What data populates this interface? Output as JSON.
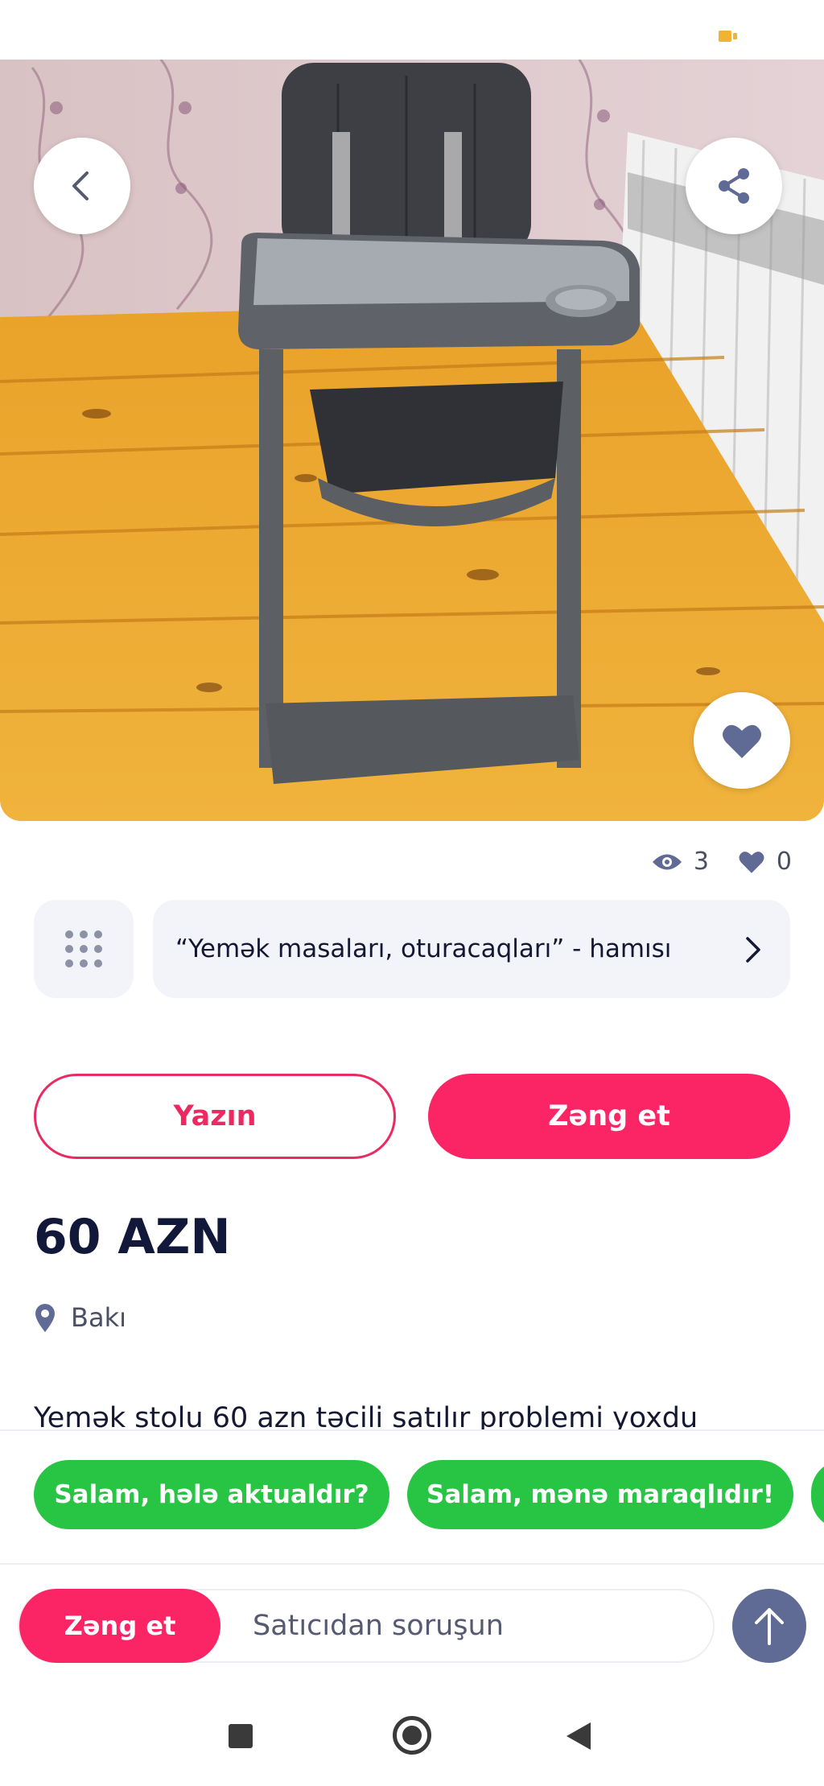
{
  "stats": {
    "views": "3",
    "likes": "0"
  },
  "category": {
    "label": "“Yemək masaları, oturacaqları” - hamısı"
  },
  "actions": {
    "write_label": "Yazın",
    "call_label": "Zəng et"
  },
  "listing": {
    "price": "60 AZN",
    "location": "Bakı",
    "description": "Yemək stolu 60 azn təcili satılır problemi yoxdu"
  },
  "quick_replies": [
    "Salam, hələ aktualdır?",
    "Salam, mənə maraqlıdır!"
  ],
  "composer": {
    "call_label": "Zəng et",
    "placeholder": "Satıcıdan soruşun"
  },
  "colors": {
    "accent_pink": "#fb2566",
    "chip_green": "#28c545",
    "send_blue": "#5f6a95"
  },
  "icons": [
    "battery-icon",
    "back-arrow-icon",
    "share-icon",
    "heart-icon",
    "eye-icon",
    "grid-dots-icon",
    "chevron-right-icon",
    "location-pin-icon",
    "arrow-up-icon"
  ]
}
